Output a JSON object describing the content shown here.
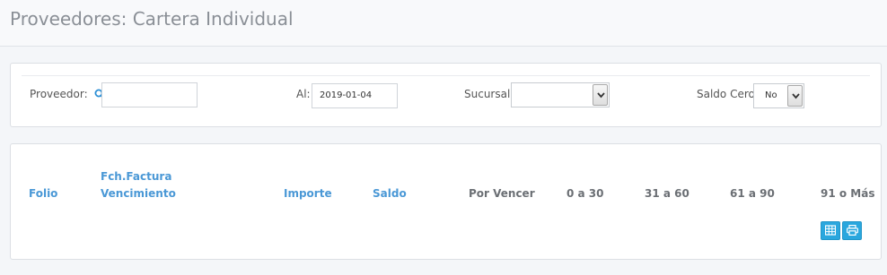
{
  "header": {
    "title": "Proveedores: Cartera Individual"
  },
  "filters": {
    "proveedor_label": "Proveedor:",
    "proveedor_value": "",
    "al_label": "Al:",
    "al_value": "2019-01-04",
    "sucursal_label": "Sucursal:",
    "sucursal_value": "",
    "saldo_cero_label": "Saldo Cero:",
    "saldo_cero_value": "No"
  },
  "table": {
    "columns": [
      {
        "label": "Folio"
      },
      {
        "label": "Fch.Factura"
      },
      {
        "label": "Vencimiento"
      },
      {
        "label": "Importe"
      },
      {
        "label": "Saldo"
      },
      {
        "label": "Por Vencer"
      },
      {
        "label": "0 a 30"
      },
      {
        "label": "31 a 60"
      },
      {
        "label": "61 a 90"
      },
      {
        "label": "91 o Más"
      }
    ],
    "actions": [
      {
        "icon": "table-icon"
      },
      {
        "icon": "print-icon"
      }
    ]
  },
  "colors": {
    "accent": "#2aa7de",
    "link": "#4a98d6",
    "title": "#8a8f96"
  }
}
